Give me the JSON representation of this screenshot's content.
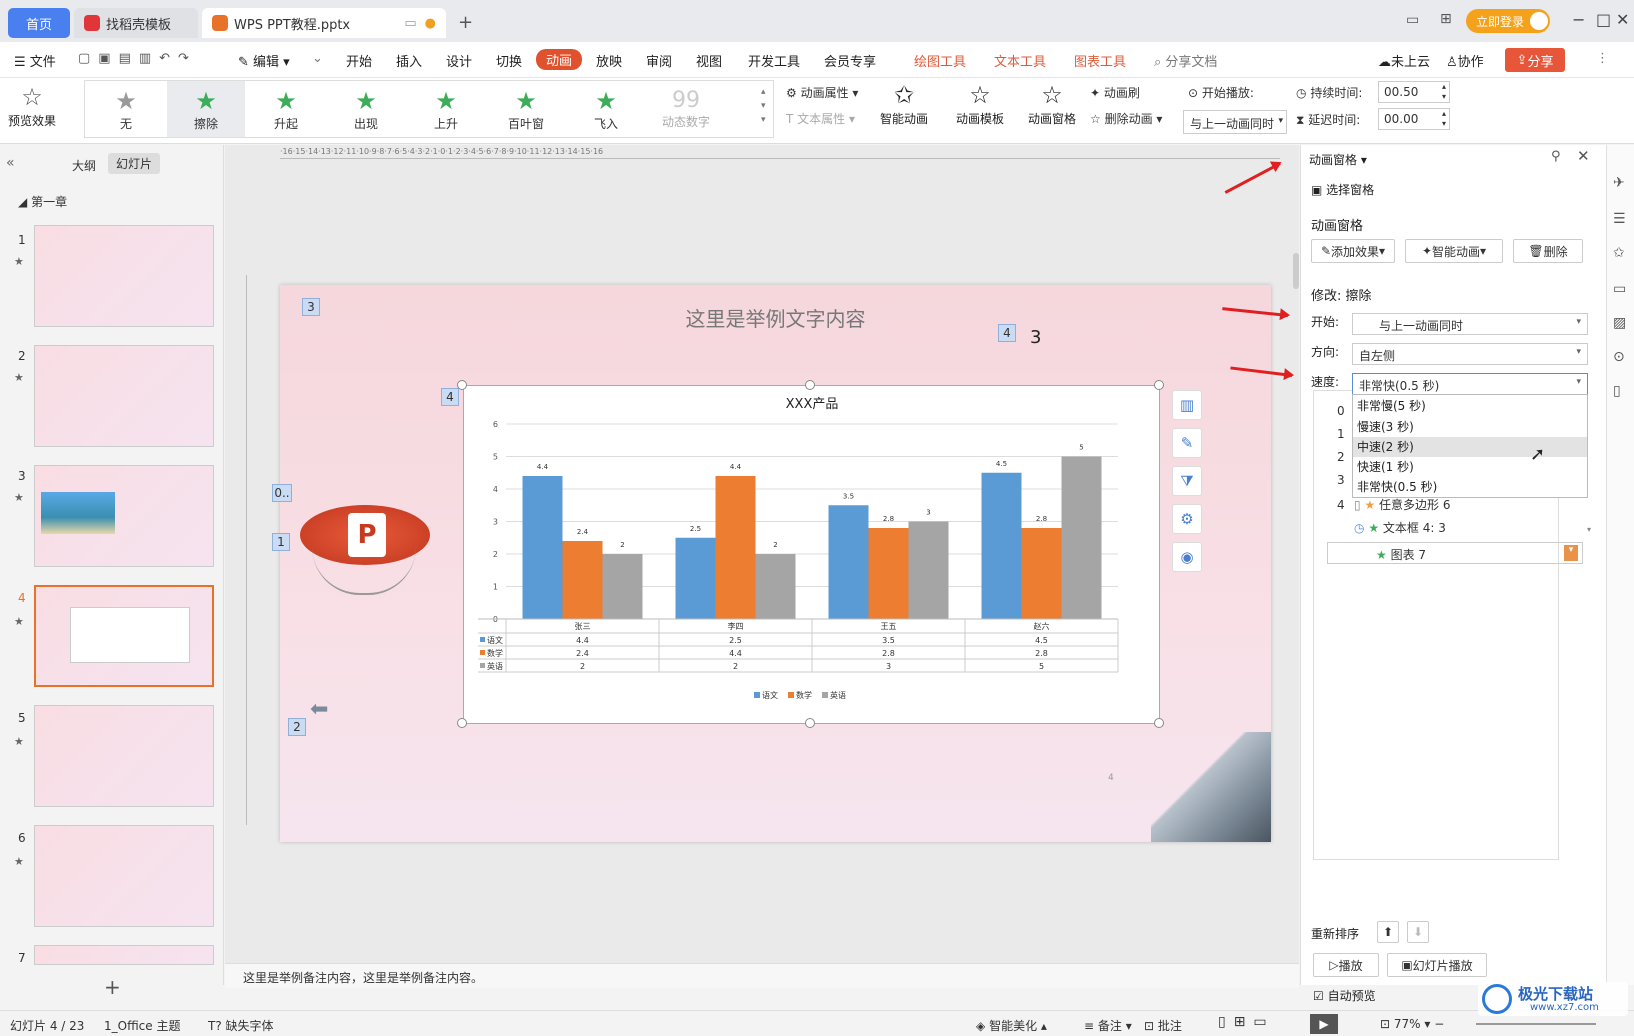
{
  "tabs": {
    "home": "首页",
    "template": "找稻壳模板",
    "file": "WPS PPT教程.pptx"
  },
  "titlebar": {
    "login": "立即登录"
  },
  "menu": {
    "file": "文件",
    "edit": "编辑",
    "items": [
      "开始",
      "插入",
      "设计",
      "切换",
      "动画",
      "放映",
      "审阅",
      "视图",
      "开发工具",
      "会员专享"
    ],
    "context": [
      "绘图工具",
      "文本工具",
      "图表工具"
    ],
    "search": "分享文档",
    "cloud": "未上云",
    "collab": "协作",
    "share": "分享"
  },
  "ribbon": {
    "preview": "预览效果",
    "effects": [
      "无",
      "擦除",
      "升起",
      "出现",
      "上升",
      "百叶窗",
      "飞入",
      "动态数字"
    ],
    "anim_prop": "动画属性",
    "text_prop": "文本属性",
    "smart_anim": "智能动画",
    "anim_template": "动画模板",
    "anim_pane": "动画窗格",
    "anim_brush": "动画刷",
    "delete_anim": "删除动画",
    "start_play": "开始播放:",
    "start_value": "与上一动画同时",
    "duration_label": "持续时间:",
    "duration_value": "00.50",
    "delay_label": "延迟时间:",
    "delay_value": "00.00"
  },
  "leftpanel": {
    "outline": "大纲",
    "slides": "幻灯片",
    "chapter": "第一章"
  },
  "slide": {
    "title": "这里是举例文字内容",
    "num3": "3",
    "badges": {
      "b3": "3",
      "b4a": "4",
      "b4b": "4",
      "b0": "0..",
      "b1": "1",
      "b2": "2"
    },
    "page_no": "4"
  },
  "chart_data": {
    "type": "bar",
    "title": "XXX产品",
    "categories": [
      "张三",
      "李四",
      "王五",
      "赵六"
    ],
    "ylim": [
      0,
      6
    ],
    "yticks": [
      "0",
      "1",
      "2",
      "3",
      "4",
      "5",
      "6"
    ],
    "series": [
      {
        "name": "语文",
        "values": [
          4.4,
          2.5,
          3.5,
          4.5
        ],
        "color": "#5b9bd5"
      },
      {
        "name": "数学",
        "values": [
          2.4,
          4.4,
          2.8,
          2.8
        ],
        "color": "#ed7d31"
      },
      {
        "name": "英语",
        "values": [
          2,
          2,
          3,
          5
        ],
        "color": "#a5a5a5"
      }
    ],
    "table": [
      [
        "4.4",
        "2.5",
        "3.5",
        "4.5"
      ],
      [
        "2.4",
        "4.4",
        "2.8",
        "2.8"
      ],
      [
        "2",
        "2",
        "3",
        "5"
      ]
    ]
  },
  "rightpanel": {
    "title": "动画窗格",
    "select_pane": "选择窗格",
    "section": "动画窗格",
    "add_effect": "添加效果",
    "smart": "智能动画",
    "delete": "删除",
    "modify": "修改: 擦除",
    "start_label": "开始:",
    "start_value": "与上一动画同时",
    "direction_label": "方向:",
    "direction_value": "自左侧",
    "speed_label": "速度:",
    "speed_value": "非常快(0.5 秒)",
    "speed_options": [
      "非常慢(5 秒)",
      "慢速(3 秒)",
      "中速(2 秒)",
      "快速(1 秒)",
      "非常快(0.5 秒)"
    ],
    "list_nums": [
      "0",
      "1",
      "2",
      "3",
      "4"
    ],
    "list_items": [
      "任意多边形 6",
      "文本框 4: 3",
      "图表 7"
    ],
    "reorder": "重新排序",
    "play": "播放",
    "slideshow": "幻灯片播放",
    "autopreview": "自动预览"
  },
  "notes": "这里是举例备注内容，这里是举例备注内容。",
  "status": {
    "slide": "幻灯片 4 / 23",
    "theme": "1_Office 主题",
    "missing_font": "缺失字体",
    "beautify": "智能美化",
    "notes": "备注",
    "comment": "批注",
    "zoom": "77%"
  },
  "watermark": {
    "text": "极光下载站",
    "url": "www.xz7.com"
  },
  "colors": {
    "accent": "#e0522e",
    "blue": "#4a7ff0"
  }
}
